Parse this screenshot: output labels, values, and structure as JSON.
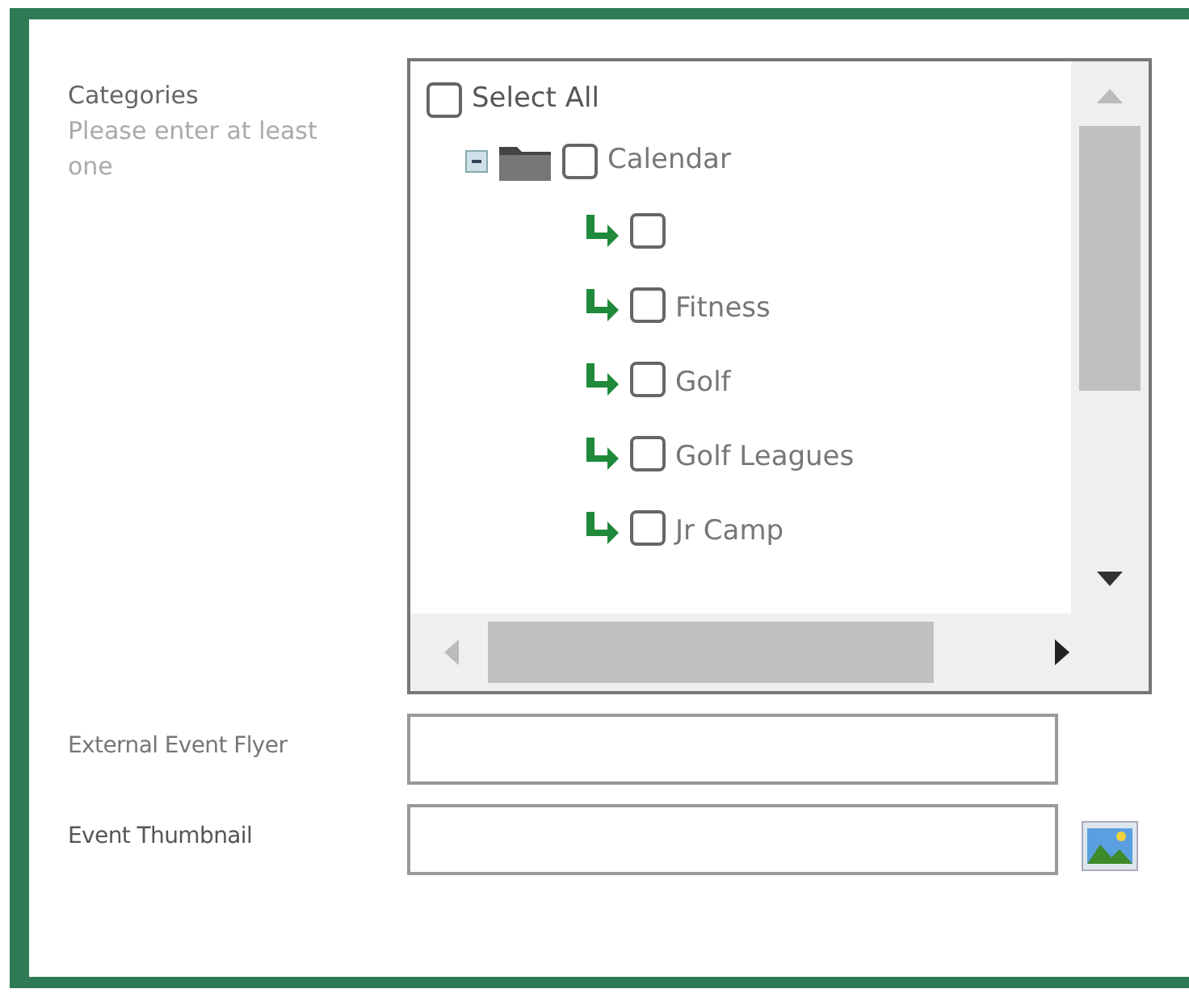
{
  "categories": {
    "label": "Categories",
    "hint": "Please enter at least one",
    "tree": {
      "select_all": {
        "label": "Select All",
        "checked": false
      },
      "items": [
        {
          "label": "Calendar",
          "checked": false,
          "expanded": true,
          "children": [
            {
              "checked": false
            },
            {
              "label": "Fitness",
              "checked": false
            },
            {
              "label": "Golf",
              "checked": false
            },
            {
              "label": "Golf Leagues",
              "checked": false
            },
            {
              "label": "Jr Camp",
              "checked": false
            }
          ]
        }
      ]
    }
  },
  "fields": [
    {
      "label": "External Event Flyer",
      "kind": "text"
    },
    {
      "label": "Event Thumbnail",
      "kind": "image"
    }
  ]
}
